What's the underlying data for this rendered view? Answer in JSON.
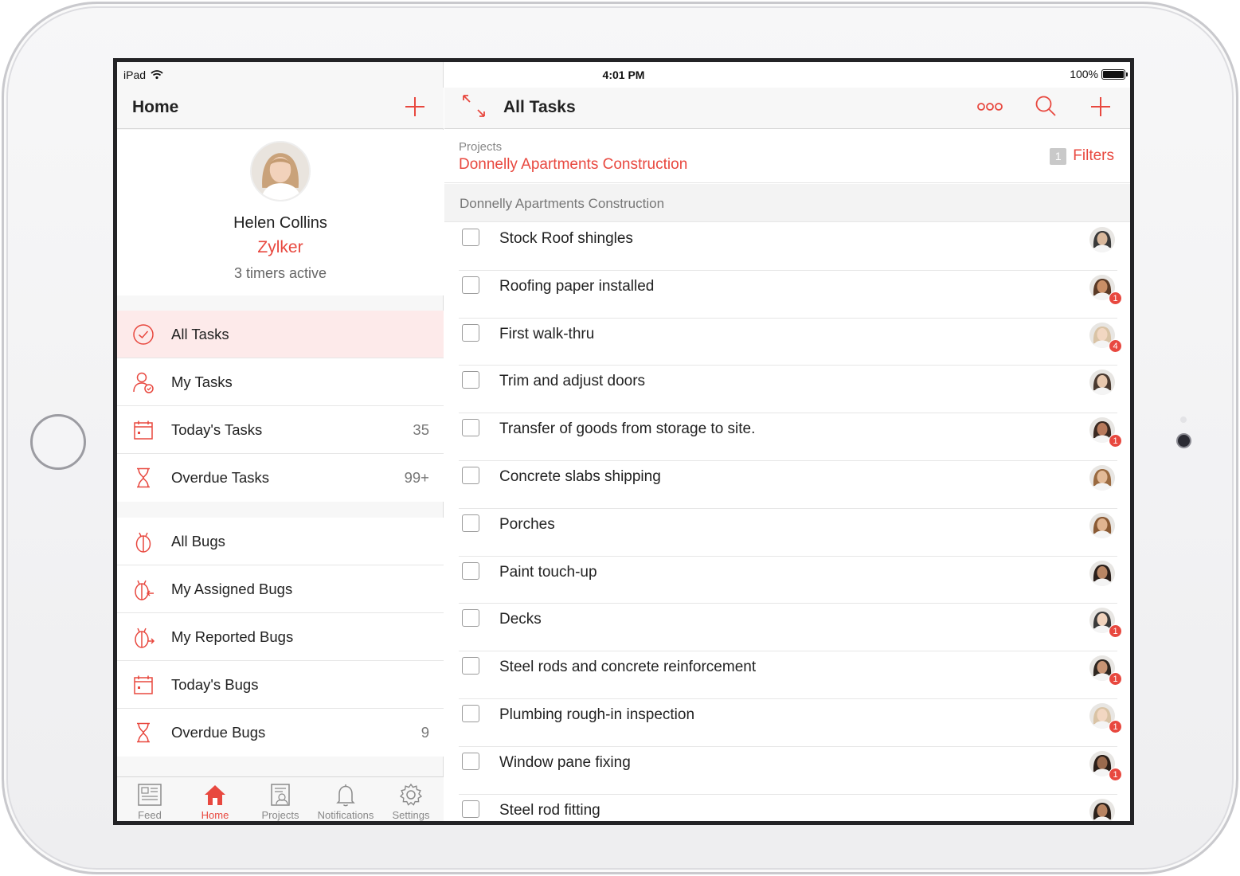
{
  "status_bar": {
    "device": "iPad",
    "time": "4:01 PM",
    "battery": "100%"
  },
  "colors": {
    "accent": "#e8483f",
    "active_row_bg": "#fdeaea"
  },
  "left": {
    "title": "Home",
    "profile": {
      "name": "Helen Collins",
      "org": "Zylker",
      "timers": "3 timers active"
    },
    "task_menu": [
      {
        "label": "All Tasks",
        "count": "",
        "icon": "check-circle-icon",
        "active": true
      },
      {
        "label": "My Tasks",
        "count": "",
        "icon": "user-task-icon"
      },
      {
        "label": "Today's Tasks",
        "count": "35",
        "icon": "calendar-icon"
      },
      {
        "label": "Overdue Tasks",
        "count": "99+",
        "icon": "hourglass-icon"
      }
    ],
    "bug_menu": [
      {
        "label": "All Bugs",
        "count": "",
        "icon": "bug-icon"
      },
      {
        "label": "My Assigned Bugs",
        "count": "",
        "icon": "bug-assigned-icon"
      },
      {
        "label": "My Reported Bugs",
        "count": "",
        "icon": "bug-reported-icon"
      },
      {
        "label": "Today's Bugs",
        "count": "",
        "icon": "calendar-icon"
      },
      {
        "label": "Overdue Bugs",
        "count": "9",
        "icon": "hourglass-icon"
      }
    ],
    "tabs": [
      {
        "label": "Feed",
        "icon": "feed-icon"
      },
      {
        "label": "Home",
        "icon": "home-icon",
        "active": true
      },
      {
        "label": "Projects",
        "icon": "projects-icon"
      },
      {
        "label": "Notifications",
        "icon": "bell-icon"
      },
      {
        "label": "Settings",
        "icon": "gear-icon"
      }
    ]
  },
  "right": {
    "title": "All Tasks",
    "project_caption": "Projects",
    "project_name": "Donnelly Apartments Construction",
    "filters_count": "1",
    "filters_label": "Filters",
    "section": "Donnelly Apartments Construction",
    "tasks": [
      {
        "label": "Stock Roof shingles",
        "badge": ""
      },
      {
        "label": "Roofing paper installed",
        "badge": "1"
      },
      {
        "label": "First walk-thru",
        "badge": "4"
      },
      {
        "label": "Trim and adjust doors",
        "badge": ""
      },
      {
        "label": "Transfer of goods from storage to site.",
        "badge": "1"
      },
      {
        "label": "Concrete slabs shipping",
        "badge": ""
      },
      {
        "label": "Porches",
        "badge": ""
      },
      {
        "label": "Paint touch-up",
        "badge": ""
      },
      {
        "label": "Decks",
        "badge": "1"
      },
      {
        "label": "Steel rods and concrete reinforcement",
        "badge": "1"
      },
      {
        "label": "Plumbing rough-in inspection",
        "badge": "1"
      },
      {
        "label": "Window pane fixing",
        "badge": "1"
      },
      {
        "label": "Steel rod fitting",
        "badge": ""
      }
    ]
  }
}
